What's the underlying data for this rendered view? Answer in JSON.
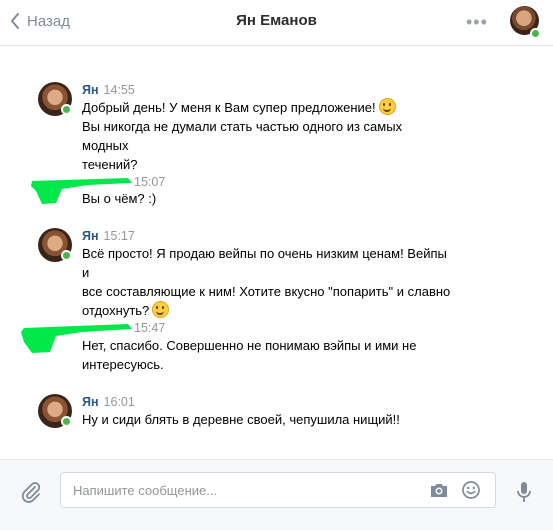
{
  "header": {
    "back_label": "Назад",
    "title": "Ян Еманов",
    "more_label": "•••"
  },
  "messages": [
    {
      "author": "Ян",
      "time": "14:55",
      "lines": [
        "Добрый день! У меня к Вам супер предложение!",
        "Вы никогда не думали стать частью одного из самых модных",
        "течений?"
      ],
      "emoji": "wink"
    },
    {
      "author": "",
      "time": "15:07",
      "lines": [
        "Вы о чём? :)"
      ]
    },
    {
      "author": "Ян",
      "time": "15:17",
      "lines": [
        "Всё просто! Я продаю вейпы по очень низким ценам! Вейпы и",
        "все составляющие к ним! Хотите вкусно \"попарить\" и славно",
        "отдохнуть?"
      ],
      "emoji": "smile"
    },
    {
      "author": "",
      "time": "15:47",
      "lines": [
        "Нет, спасибо. Совершенно не понимаю вэйпы и ими не",
        "интересуюсь."
      ]
    },
    {
      "author": "Ян",
      "time": "16:01",
      "lines": [
        "Ну и сиди блять в деревне своей, чепушила нищий!!"
      ]
    }
  ],
  "composer": {
    "placeholder": "Напишите сообщение..."
  },
  "colors": {
    "link": "#2a5885",
    "online": "#4bb34b",
    "scribble": "#00e84a"
  }
}
